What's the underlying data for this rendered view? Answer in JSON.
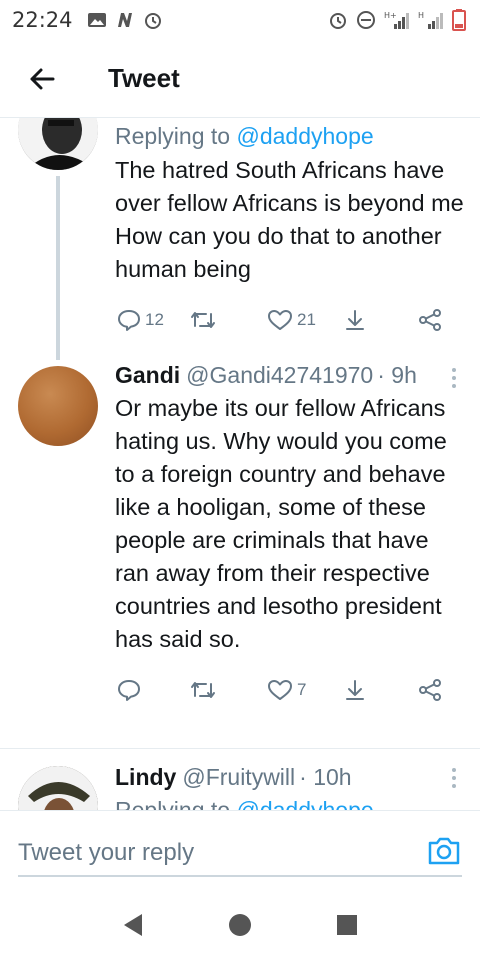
{
  "status_bar": {
    "time": "22:24",
    "left_icons": [
      "image-icon",
      "n-badge-icon",
      "alarm-icon"
    ],
    "right_icons": [
      "alarm-icon",
      "do-not-disturb-icon",
      "signal-hplus-icon",
      "signal-h-icon",
      "battery-low-icon"
    ],
    "network_1": "H+",
    "network_2": "H"
  },
  "header": {
    "title": "Tweet",
    "back_icon": "arrow-left-icon"
  },
  "tweets": [
    {
      "reply_prefix": "Replying to",
      "reply_handle": "@daddyhope",
      "text": "The hatred South Africans have over fellow Africans is beyond me How can you do that to another human being",
      "reply_count": "12",
      "retweet_count": "",
      "like_count": "21"
    },
    {
      "name": "Gandi",
      "handle": "@Gandi42741970",
      "time": "· 9h",
      "text": "Or maybe its our fellow Africans hating us. Why would you come to a foreign country and behave like a hooligan, some of these people are criminals that have ran away from their respective countries and lesotho president has said so.",
      "reply_count": "",
      "retweet_count": "",
      "like_count": "7"
    },
    {
      "name": "Lindy",
      "handle": "@Fruitywill",
      "time": "· 10h",
      "reply_prefix": "Replying to",
      "reply_handle": "@daddyhope"
    }
  ],
  "reply_bar": {
    "placeholder": "Tweet your reply",
    "camera_icon": "camera-icon"
  },
  "nav": {
    "back_icon": "triangle-back-icon",
    "home_icon": "circle-home-icon",
    "recents_icon": "square-recents-icon"
  },
  "colors": {
    "accent": "#1da1f2",
    "text": "#14171a",
    "muted": "#657786",
    "divider": "#e6ecf0"
  }
}
